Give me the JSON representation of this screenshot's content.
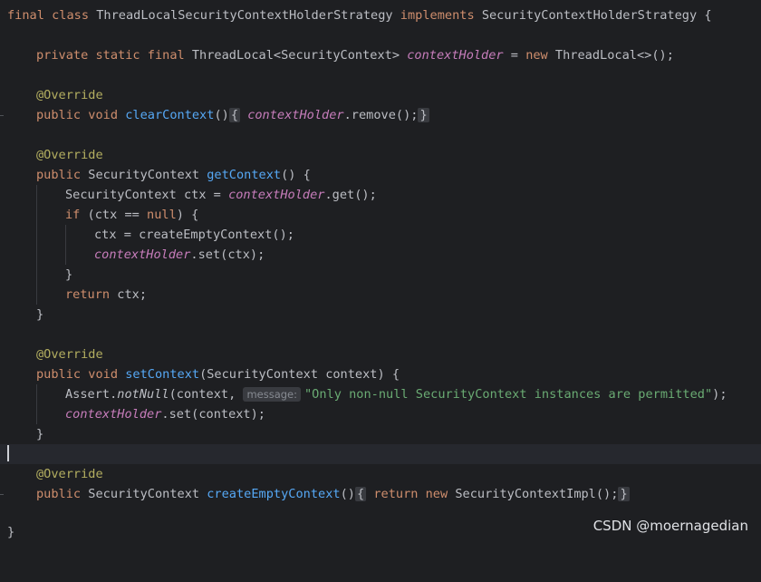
{
  "editor": {
    "class_decl": {
      "kw_final": "final",
      "kw_class": "class",
      "class_name": "ThreadLocalSecurityContextHolderStrategy",
      "kw_implements": "implements",
      "interface_name": "SecurityContextHolderStrategy",
      "open": " {"
    },
    "field_decl": {
      "mods": "private static final",
      "type": "ThreadLocal<SecurityContext>",
      "name": "contextHolder",
      "assign": " = ",
      "kw_new": "new",
      "init": " ThreadLocal<>();"
    },
    "annotation": "@Override",
    "clear": {
      "mods": "public void",
      "name": "clearContext",
      "parens": "()",
      "fold_open": "{",
      "field": "contextHolder",
      "call": ".remove();",
      "fold_close": "}"
    },
    "get": {
      "mod": "public",
      "type": "SecurityContext",
      "name": "getContext",
      "sig_rest": "() {",
      "line1_a": "SecurityContext ctx = ",
      "line1_field": "contextHolder",
      "line1_b": ".get();",
      "if_kw": "if",
      "if_a": " (ctx == ",
      "if_null": "null",
      "if_b": ") {",
      "inner1": "ctx = createEmptyContext();",
      "inner2_field": "contextHolder",
      "inner2_b": ".set(ctx);",
      "close_if": "}",
      "return_kw": "return",
      "return_b": " ctx;",
      "close": "}"
    },
    "set": {
      "mods": "public void",
      "name": "setContext",
      "sig_rest": "(SecurityContext context) {",
      "assert_a": "Assert.",
      "assert_fn": "notNull",
      "assert_b": "(context, ",
      "hint": "message:",
      "message": "\"Only non-null SecurityContext instances are permitted\"",
      "assert_end": ");",
      "line2_field": "contextHolder",
      "line2_b": ".set(context);",
      "close": "}"
    },
    "create": {
      "mod": "public",
      "type": "SecurityContext",
      "name": "createEmptyContext",
      "parens": "()",
      "fold_open": "{",
      "return_kw": "return",
      "new_kw": "new",
      "body": " SecurityContextImpl();",
      "fold_close": "}"
    },
    "class_close": "}"
  },
  "watermark": "CSDN @moernagedian",
  "colors": {
    "background": "#1e1f22",
    "keyword": "#cf8e6d",
    "function": "#56a8f5",
    "field": "#c77dbb",
    "annotation": "#b3ae60",
    "string": "#6aab73",
    "text": "#bcbec4"
  }
}
